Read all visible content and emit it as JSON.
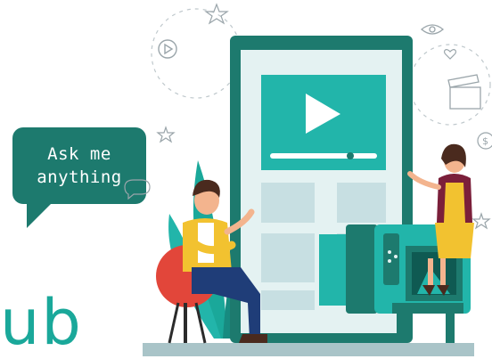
{
  "bubble": {
    "text": "Ask me\nanything"
  },
  "brand": {
    "partial_word": "ub"
  },
  "illustration": {
    "subject": "people-presenting-video-content",
    "icons": [
      "play-icon",
      "star-icon",
      "eye-icon",
      "heart-icon",
      "clapperboard-icon",
      "dollar-icon",
      "chat-icon",
      "camera-icon"
    ]
  },
  "colors": {
    "accent": "#1d7a6e",
    "teal": "#22b5aa",
    "dark_teal": "#17665d",
    "yellow": "#f2c230",
    "red": "#e2463a"
  }
}
